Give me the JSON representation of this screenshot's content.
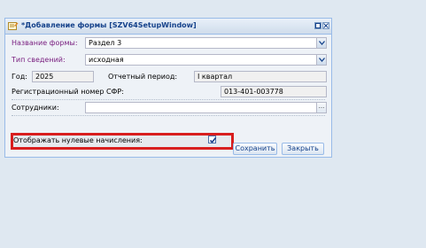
{
  "window": {
    "title": "*Добавление формы [SZV64SetupWindow]",
    "tool_buttons": [
      "maximize",
      "close"
    ]
  },
  "form": {
    "form_name": {
      "label": "Название формы:",
      "value": "Раздел 3"
    },
    "info_type": {
      "label": "Тип сведений:",
      "value": "исходная"
    },
    "year": {
      "label": "Год:",
      "value": "2025"
    },
    "period": {
      "label": "Отчетный период:",
      "value": "I квартал"
    },
    "reg_number": {
      "label": "Регистрационный номер СФР:",
      "value": "013-401-003778"
    },
    "employees": {
      "label": "Сотрудники:",
      "value": "",
      "picker": "..."
    },
    "show_zero": {
      "label": "Отображать нулевые начисления:",
      "checked": true
    }
  },
  "buttons": {
    "save": "Сохранить",
    "close": "Закрыть"
  },
  "colors": {
    "highlight": "#d81e1e",
    "required_label": "#7a2080",
    "title": "#15428b"
  },
  "icons": {
    "window": "form-edit-icon",
    "dropdown": "chevron-down-icon",
    "check": "check-icon"
  }
}
